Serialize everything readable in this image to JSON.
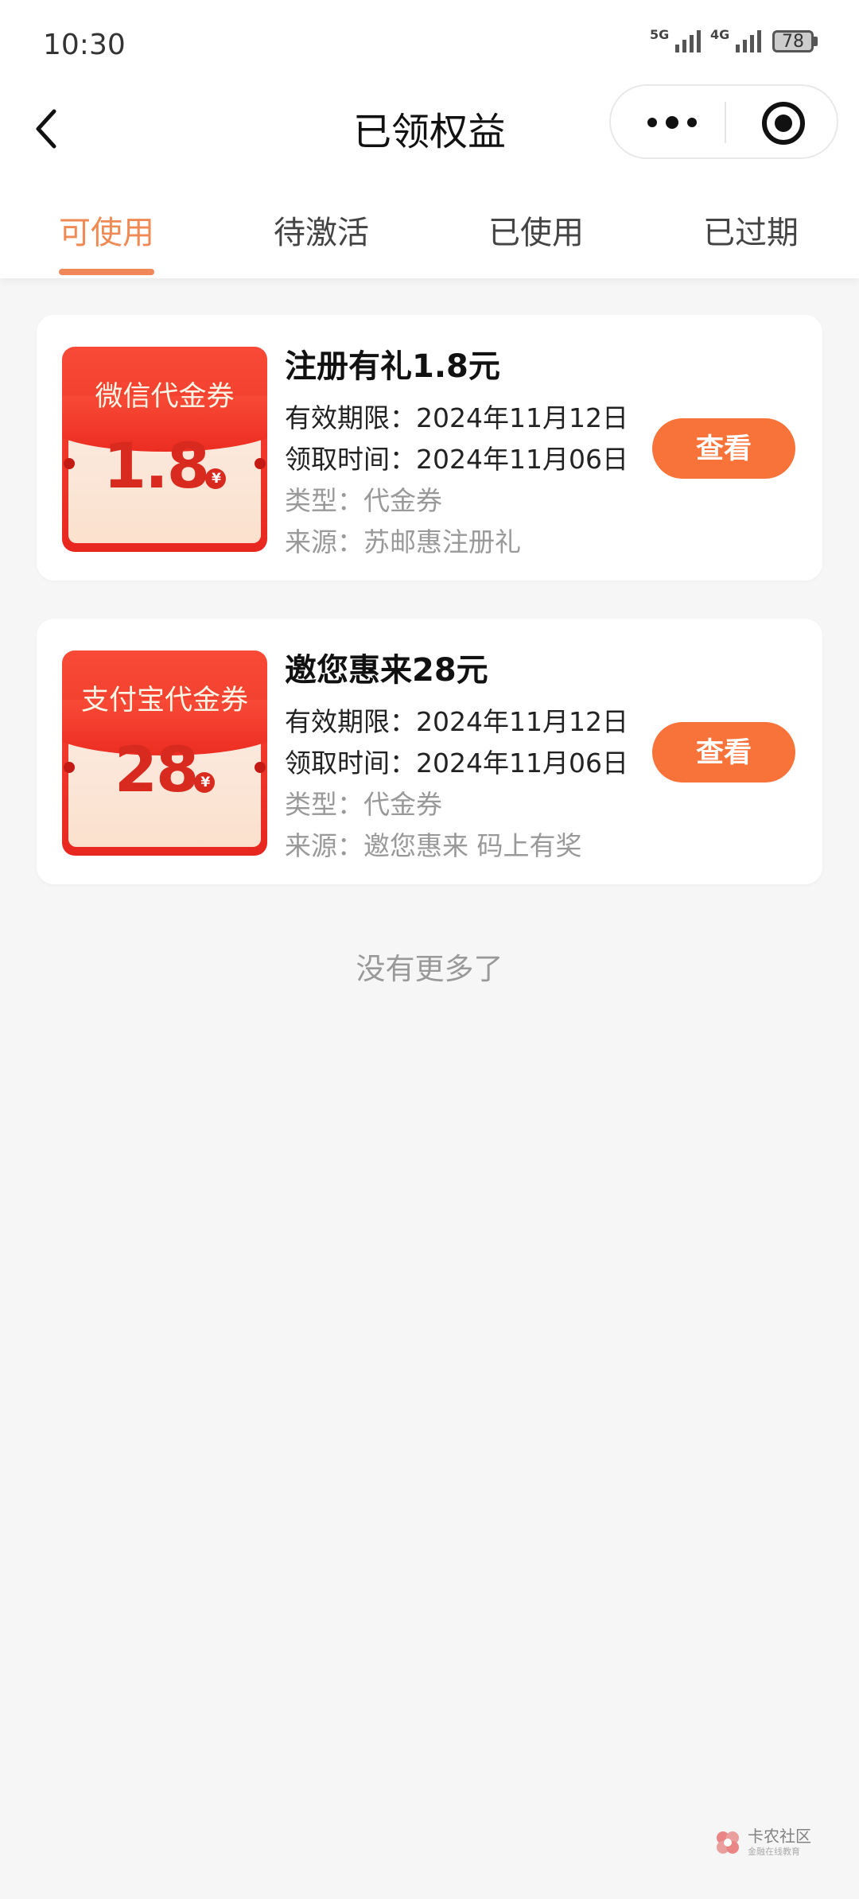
{
  "status_bar": {
    "time": "10:30",
    "net1": "5G",
    "net2": "4G",
    "battery": "78"
  },
  "nav": {
    "title": "已领权益"
  },
  "tabs": [
    {
      "label": "可使用",
      "active": true
    },
    {
      "label": "待激活",
      "active": false
    },
    {
      "label": "已使用",
      "active": false
    },
    {
      "label": "已过期",
      "active": false
    }
  ],
  "coupons": [
    {
      "badge_title": "微信代金券",
      "amount": "1.8",
      "currency": "¥",
      "name": "注册有礼1.8元",
      "valid": "有效期限：2024年11月12日",
      "received": "领取时间：2024年11月06日",
      "type": "类型：代金券",
      "source": "来源：苏邮惠注册礼",
      "button": "查看"
    },
    {
      "badge_title": "支付宝代金券",
      "amount": "28",
      "currency": "¥",
      "name": "邀您惠来28元",
      "valid": "有效期限：2024年11月12日",
      "received": "领取时间：2024年11月06日",
      "type": "类型：代金券",
      "source": "来源：邀您惠来 码上有奖",
      "button": "查看"
    }
  ],
  "footer_text": "没有更多了",
  "watermark": {
    "name": "卡农社区",
    "sub": "金融在线教育"
  },
  "colors": {
    "accent": "#f08a55",
    "button": "#f7733a",
    "coupon_red": "#e8271f"
  }
}
